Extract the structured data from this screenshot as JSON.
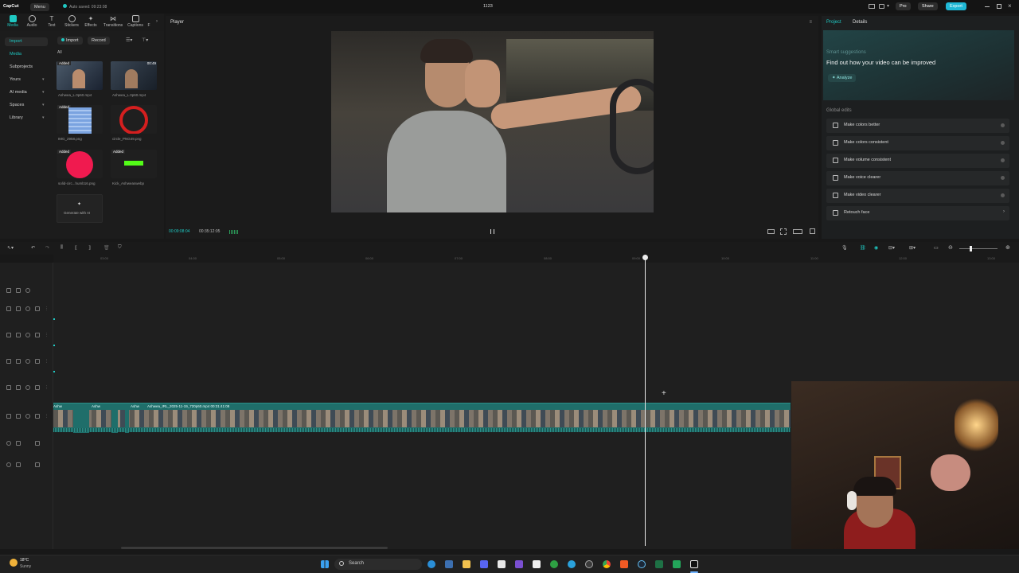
{
  "titlebar": {
    "app_name": "CapCut",
    "menu_label": "Menu",
    "autosave_text": "Auto saved: 09:23:08",
    "project_title": "1123",
    "pro_label": "Pro",
    "share_label": "Share",
    "export_label": "Export"
  },
  "toolbar": {
    "items": [
      "Media",
      "Audio",
      "Text",
      "Stickers",
      "Effects",
      "Transitions",
      "Captions",
      "F"
    ]
  },
  "left_nav": {
    "import_label": "Import",
    "items": [
      "Media",
      "Subprojects",
      "Yours",
      "AI media",
      "Spaces",
      "Library"
    ]
  },
  "media_toolbar": {
    "import_button": "Import",
    "record_button": "Record",
    "filter_all": "All"
  },
  "media_items": [
    {
      "label": "Ashwea_L.0p60.mp4",
      "badge": "Added",
      "duration": ""
    },
    {
      "label": "Ashwea_L.0p60.mp4",
      "badge": "",
      "duration": "00:49"
    },
    {
      "label": "IMG_2958.png",
      "badge": "Added",
      "duration": ""
    },
    {
      "label": "circle_PNG49.png",
      "badge": "",
      "duration": ""
    },
    {
      "label": "solid-circ...humb16.png",
      "badge": "Added",
      "duration": ""
    },
    {
      "label": "Kick_Ashweaswebp",
      "badge": "Added",
      "duration": ""
    }
  ],
  "generate_ai": "Generate with AI",
  "player": {
    "title": "Player",
    "current_time": "00:09:08:04",
    "total_time": "00:35:12:05"
  },
  "right_panel": {
    "tab_project": "Project",
    "tab_details": "Details",
    "smart_suggestions": "Smart suggestions",
    "headline": "Find out how your video can be improved",
    "analyze_button": "Analyze",
    "global_edits": "Global edits",
    "edits": [
      "Make colors better",
      "Make colors consistent",
      "Make volume consistent",
      "Make voice clearer",
      "Make video clearer",
      "Retouch face"
    ]
  },
  "ruler_ticks": [
    "03:00",
    "04:00",
    "05:00",
    "06:00",
    "07:00",
    "08:00",
    "09:00",
    "10:00",
    "11:00",
    "12:00",
    "13:00"
  ],
  "clip": {
    "labels": [
      "Ashw",
      "Ashw",
      "Ashw",
      "Ashwea_IRL_2025-11-19_720p60.mp4   00:31:41:08"
    ]
  },
  "taskbar": {
    "temperature": "18°C",
    "weather": "Sunny",
    "search_label": "Search"
  },
  "colors": {
    "accent": "#1fc8c2",
    "export_bg": "#1fb8d6",
    "clip": "#1f6e6a"
  }
}
